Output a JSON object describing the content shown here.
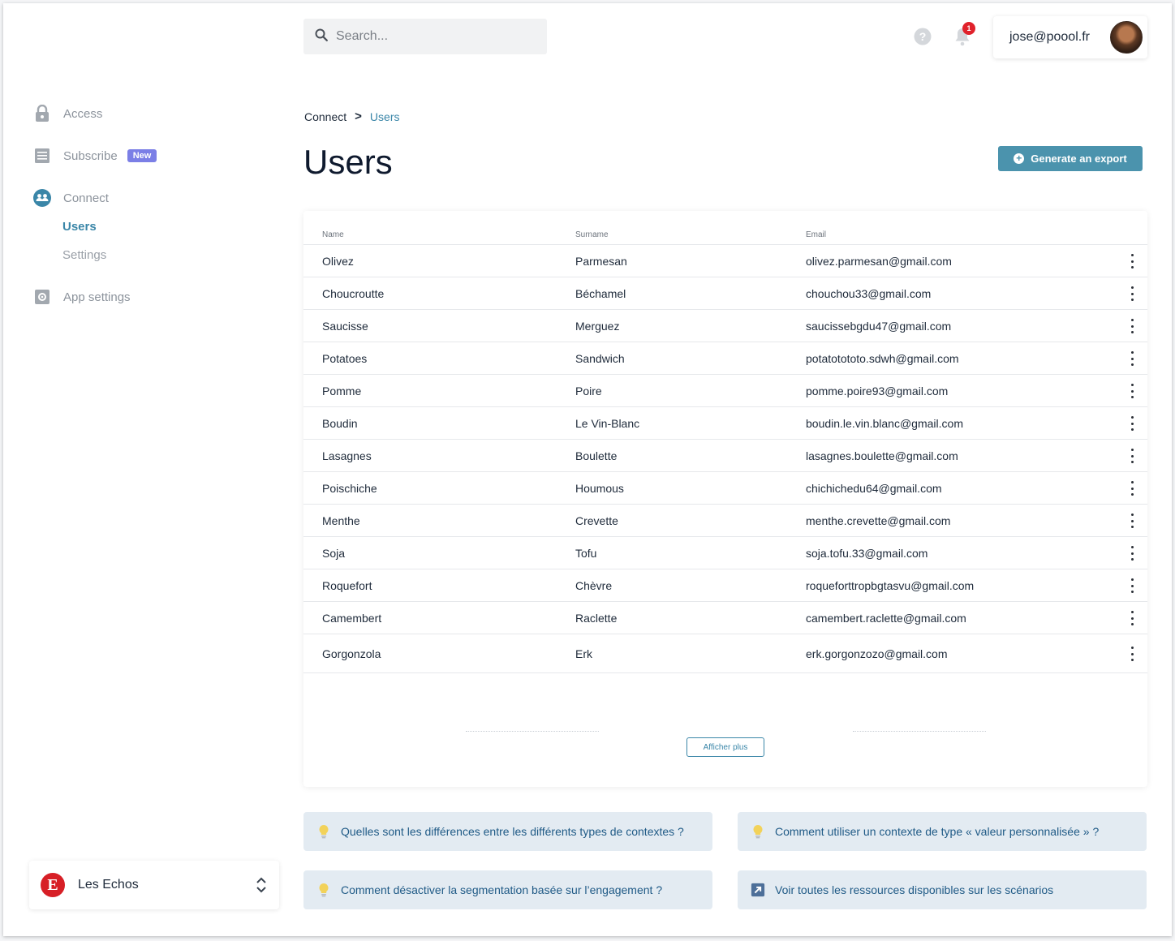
{
  "search": {
    "placeholder": "Search..."
  },
  "header": {
    "notification_count": "1",
    "user_email": "jose@poool.fr"
  },
  "sidebar": {
    "items": [
      {
        "label": "Access",
        "icon": "lock-icon"
      },
      {
        "label": "Subscribe",
        "icon": "document-icon",
        "badge": "New"
      },
      {
        "label": "Connect",
        "icon": "people-icon"
      },
      {
        "label": "App settings",
        "icon": "gear-icon"
      }
    ],
    "connect_subitems": [
      {
        "label": "Users",
        "active": true
      },
      {
        "label": "Settings",
        "active": false
      }
    ],
    "organization": {
      "logo_letter": "E",
      "name": "Les Echos"
    }
  },
  "breadcrumb": {
    "parent": "Connect",
    "separator": ">",
    "current": "Users"
  },
  "page": {
    "title": "Users",
    "export_label": "Generate an export"
  },
  "table": {
    "columns": [
      "Name",
      "Surname",
      "Email"
    ],
    "rows": [
      {
        "name": "Olivez",
        "surname": "Parmesan",
        "email": "olivez.parmesan@gmail.com"
      },
      {
        "name": "Choucroutte",
        "surname": "Béchamel",
        "email": "chouchou33@gmail.com"
      },
      {
        "name": "Saucisse",
        "surname": "Merguez",
        "email": "saucissebgdu47@gmail.com"
      },
      {
        "name": "Potatoes",
        "surname": "Sandwich",
        "email": "potatotototo.sdwh@gmail.com"
      },
      {
        "name": "Pomme",
        "surname": "Poire",
        "email": "pomme.poire93@gmail.com"
      },
      {
        "name": "Boudin",
        "surname": "Le Vin-Blanc",
        "email": "boudin.le.vin.blanc@gmail.com"
      },
      {
        "name": "Lasagnes",
        "surname": "Boulette",
        "email": "lasagnes.boulette@gmail.com"
      },
      {
        "name": "Poischiche",
        "surname": "Houmous",
        "email": "chichichedu64@gmail.com"
      },
      {
        "name": "Menthe",
        "surname": "Crevette",
        "email": "menthe.crevette@gmail.com"
      },
      {
        "name": "Soja",
        "surname": "Tofu",
        "email": "soja.tofu.33@gmail.com"
      },
      {
        "name": "Roquefort",
        "surname": "Chèvre",
        "email": "roqueforttropbgtasvu@gmail.com"
      },
      {
        "name": "Camembert",
        "surname": "Raclette",
        "email": "camembert.raclette@gmail.com"
      },
      {
        "name": "Gorgonzola",
        "surname": "Erk",
        "email": "erk.gorgonzozo@gmail.com"
      }
    ],
    "show_more_label": "Afficher plus"
  },
  "tips": [
    {
      "text": "Quelles sont les différences entre les différents types de contextes ?",
      "icon": "lightbulb-icon"
    },
    {
      "text": "Comment utiliser un contexte de type « valeur personnalisée » ?",
      "icon": "lightbulb-icon"
    },
    {
      "text": "Comment désactiver la segmentation basée sur l’engagement ?",
      "icon": "lightbulb-icon"
    },
    {
      "text": "Voir toutes les ressources disponibles sur les scénarios",
      "icon": "external-link-icon"
    }
  ],
  "colors": {
    "accent": "#3a86a8",
    "export_button": "#4b93ad",
    "badge_new": "#7b7fe6",
    "notification": "#e0222b",
    "tip_background": "#e3ebf2"
  }
}
